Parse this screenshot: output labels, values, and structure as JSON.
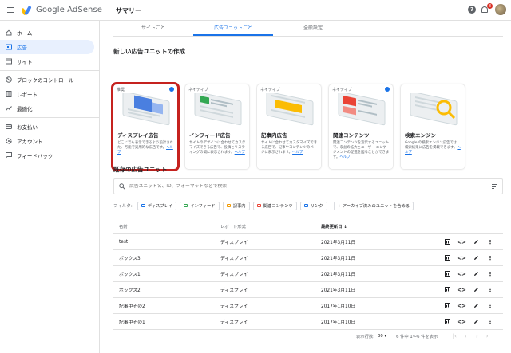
{
  "app": {
    "name": "Google AdSense",
    "page_title": "サマリー",
    "notification_count": "8",
    "accent": "#1a73e8",
    "highlight": "#c5221f"
  },
  "sidebar": {
    "items": [
      {
        "label": "ホーム",
        "icon": "home-icon"
      },
      {
        "label": "広告",
        "icon": "ads-icon",
        "active": true
      },
      {
        "label": "サイト",
        "icon": "sites-icon"
      },
      {
        "label": "ブロックのコントロール",
        "icon": "block-icon"
      },
      {
        "label": "レポート",
        "icon": "report-icon"
      },
      {
        "label": "最適化",
        "icon": "optimize-icon"
      },
      {
        "label": "お支払い",
        "icon": "payments-icon"
      },
      {
        "label": "アカウント",
        "icon": "account-icon"
      },
      {
        "label": "フィードバック",
        "icon": "feedback-icon"
      }
    ]
  },
  "tabs": [
    {
      "label": "サイトごと"
    },
    {
      "label": "広告ユニットごと",
      "active": true
    },
    {
      "label": "全般設定"
    }
  ],
  "create_section": {
    "title": "新しい広告ユニットの作成",
    "cards": [
      {
        "tag": "推奨",
        "title": "ディスプレイ広告",
        "desc": "どこにでも表示できるよう設計された、万能で実用的な広告です。",
        "help": "ヘルプ",
        "badge": true,
        "selected": true
      },
      {
        "tag": "ネイティブ",
        "title": "インフィード広告",
        "desc": "サイトのデザインに合わせてカスタマイズできる広告で、投稿とリスティングの間に表示されます。",
        "help": "ヘルプ",
        "badge": false
      },
      {
        "tag": "ネイティブ",
        "title": "記事内広告",
        "desc": "サイトに合わせてカスタマイズできる広告で、記事やコンテンツのページに表示されます。",
        "help": "ヘルプ",
        "badge": false
      },
      {
        "tag": "ネイティブ",
        "title": "関連コンテンツ",
        "desc": "関連コンテンツを宣伝するユニットで、収益の拡大とユーザー エンゲージメントの促進を図ることができます。",
        "help": "ヘルプ",
        "badge": true
      },
      {
        "tag": "",
        "title": "検索エンジン",
        "desc": "Google の検索エンジン広告では、検索結果に広告を掲載できます。",
        "help": "ヘルプ",
        "badge": false
      }
    ]
  },
  "existing": {
    "title": "既存の広告ユニット",
    "search_placeholder": "広告ユニット名、ID、フォーマットなどで検索",
    "filter_label": "フィルタ:",
    "filters": [
      "ディスプレイ",
      "インフィード",
      "記事内",
      "関連コンテンツ",
      "リンク"
    ],
    "archive_chip": "+ アーカイブ済みのユニットを含める",
    "columns": {
      "name": "名前",
      "type": "レポート形式",
      "updated": "最終更新日 ↓"
    },
    "rows": [
      {
        "name": "test",
        "type": "ディスプレイ",
        "updated": "2021年3月11日"
      },
      {
        "name": "ボックス3",
        "type": "ディスプレイ",
        "updated": "2021年3月11日"
      },
      {
        "name": "ボックス1",
        "type": "ディスプレイ",
        "updated": "2021年3月11日"
      },
      {
        "name": "ボックス2",
        "type": "ディスプレイ",
        "updated": "2021年3月11日"
      },
      {
        "name": "記事中その2",
        "type": "ディスプレイ",
        "updated": "2017年1月10日"
      },
      {
        "name": "記事中その1",
        "type": "ディスプレイ",
        "updated": "2017年1月10日"
      }
    ],
    "pager": {
      "rows_label": "表示行数:",
      "rows_value": "30 ▾",
      "range": "6 件中 1〜6 件を表示"
    }
  }
}
